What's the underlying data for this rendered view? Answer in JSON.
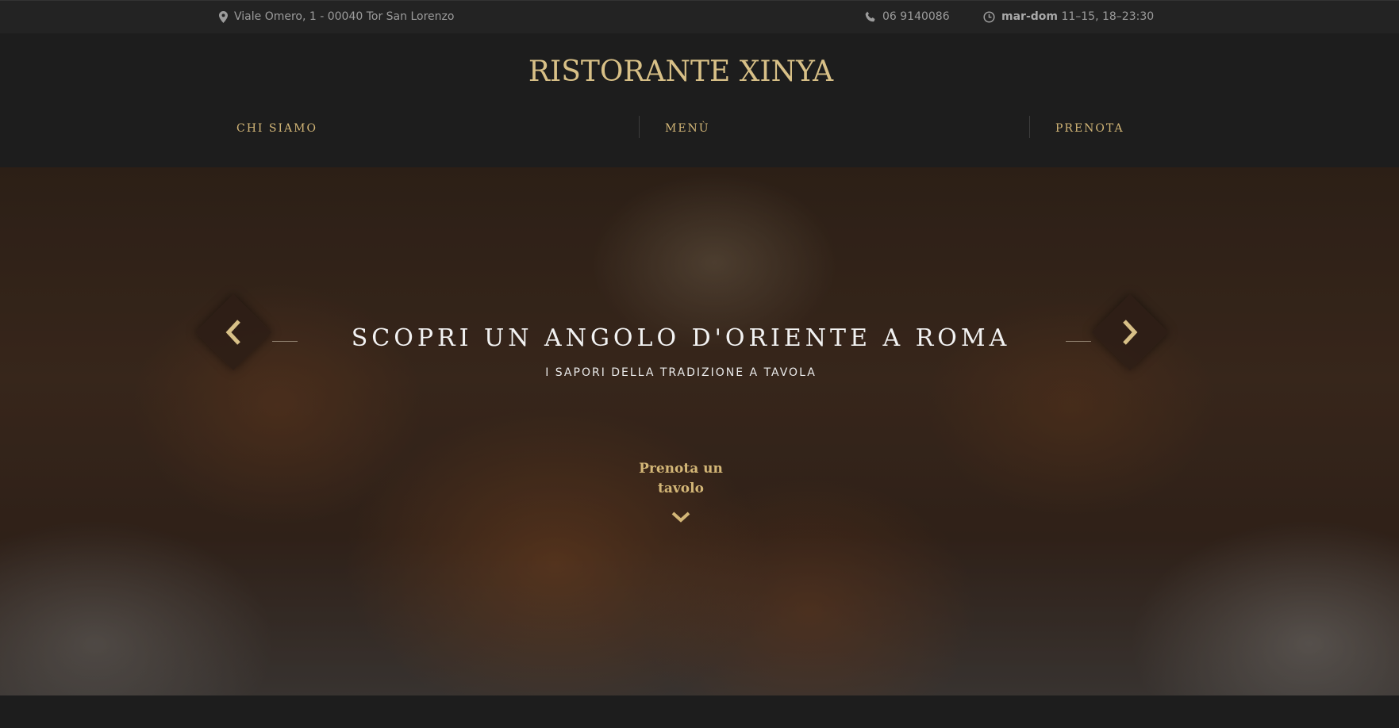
{
  "topbar": {
    "address": "Viale Omero, 1 - 00040 Tor San Lorenzo",
    "phone": "06 9140086",
    "hours_days": "mar-dom",
    "hours_times": "11–15, 18–23:30"
  },
  "header": {
    "brand": "RISTORANTE XINYA",
    "nav": [
      {
        "label": "CHI SIAMO"
      },
      {
        "label": "MENÙ"
      },
      {
        "label": "PRENOTA"
      }
    ]
  },
  "hero": {
    "title": "SCOPRI UN ANGOLO D'ORIENTE A ROMA",
    "subtitle": "I SAPORI DELLA TRADIZIONE A TAVOLA",
    "cta_line1": "Prenota un",
    "cta_line2": "tavolo"
  },
  "icons": {
    "address": "map-pin-icon",
    "phone": "phone-icon",
    "hours": "clock-icon",
    "prev": "chevron-left-icon",
    "next": "chevron-right-icon",
    "scroll": "chevron-down-icon"
  },
  "colors": {
    "accent": "#d3b677",
    "brand": "#d8c087",
    "background": "#1d1d1d",
    "topbar": "#232323"
  }
}
